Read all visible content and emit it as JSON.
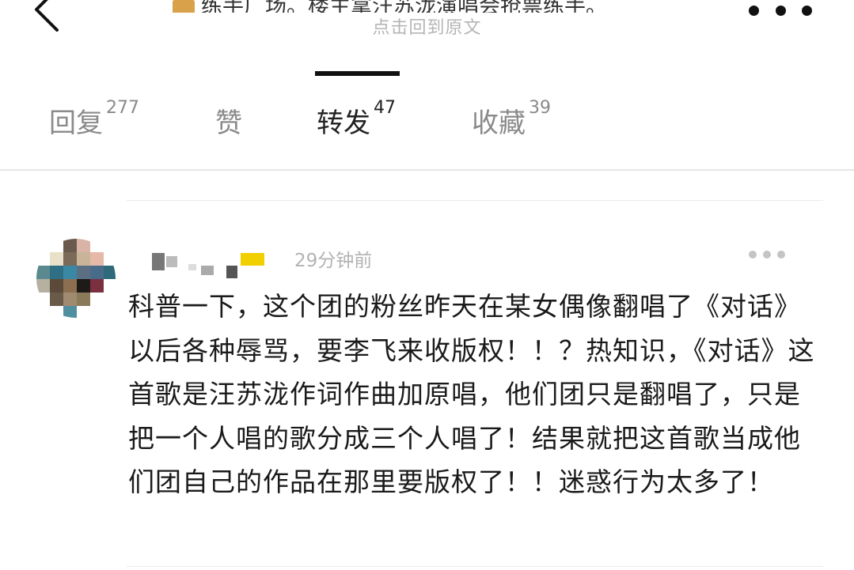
{
  "header": {
    "title_partial": "练手广场。楼主拿汪苏泷演唱会抢票练手。",
    "subtitle": "点击回到原文",
    "back_icon": "chevron-left-icon",
    "more_icon": "more-dots-icon"
  },
  "tabs": [
    {
      "label": "回复",
      "count": "277"
    },
    {
      "label": "赞",
      "count": ""
    },
    {
      "label": "转发",
      "count": "47"
    },
    {
      "label": "收藏",
      "count": "39"
    }
  ],
  "active_tab": "转发",
  "comment": {
    "timestamp": "29分钟前",
    "text": "科普一下，这个团的粉丝昨天在某女偶像翻唱了《对话》以后各种辱骂，要李飞来收版权！！？热知识，《对话》这首歌是汪苏泷作词作曲加原唱，他们团只是翻唱了，只是把一个人唱的歌分成三个人唱了！结果就把这首歌当成他们团自己的作品在那里要版权了！！迷惑行为太多了！"
  },
  "colors": {
    "text_primary": "#1a1a1a",
    "text_muted": "#b3b3b3",
    "tab_inactive": "#8a8a8a",
    "indicator": "#111111",
    "divider": "#e6e6e6"
  }
}
